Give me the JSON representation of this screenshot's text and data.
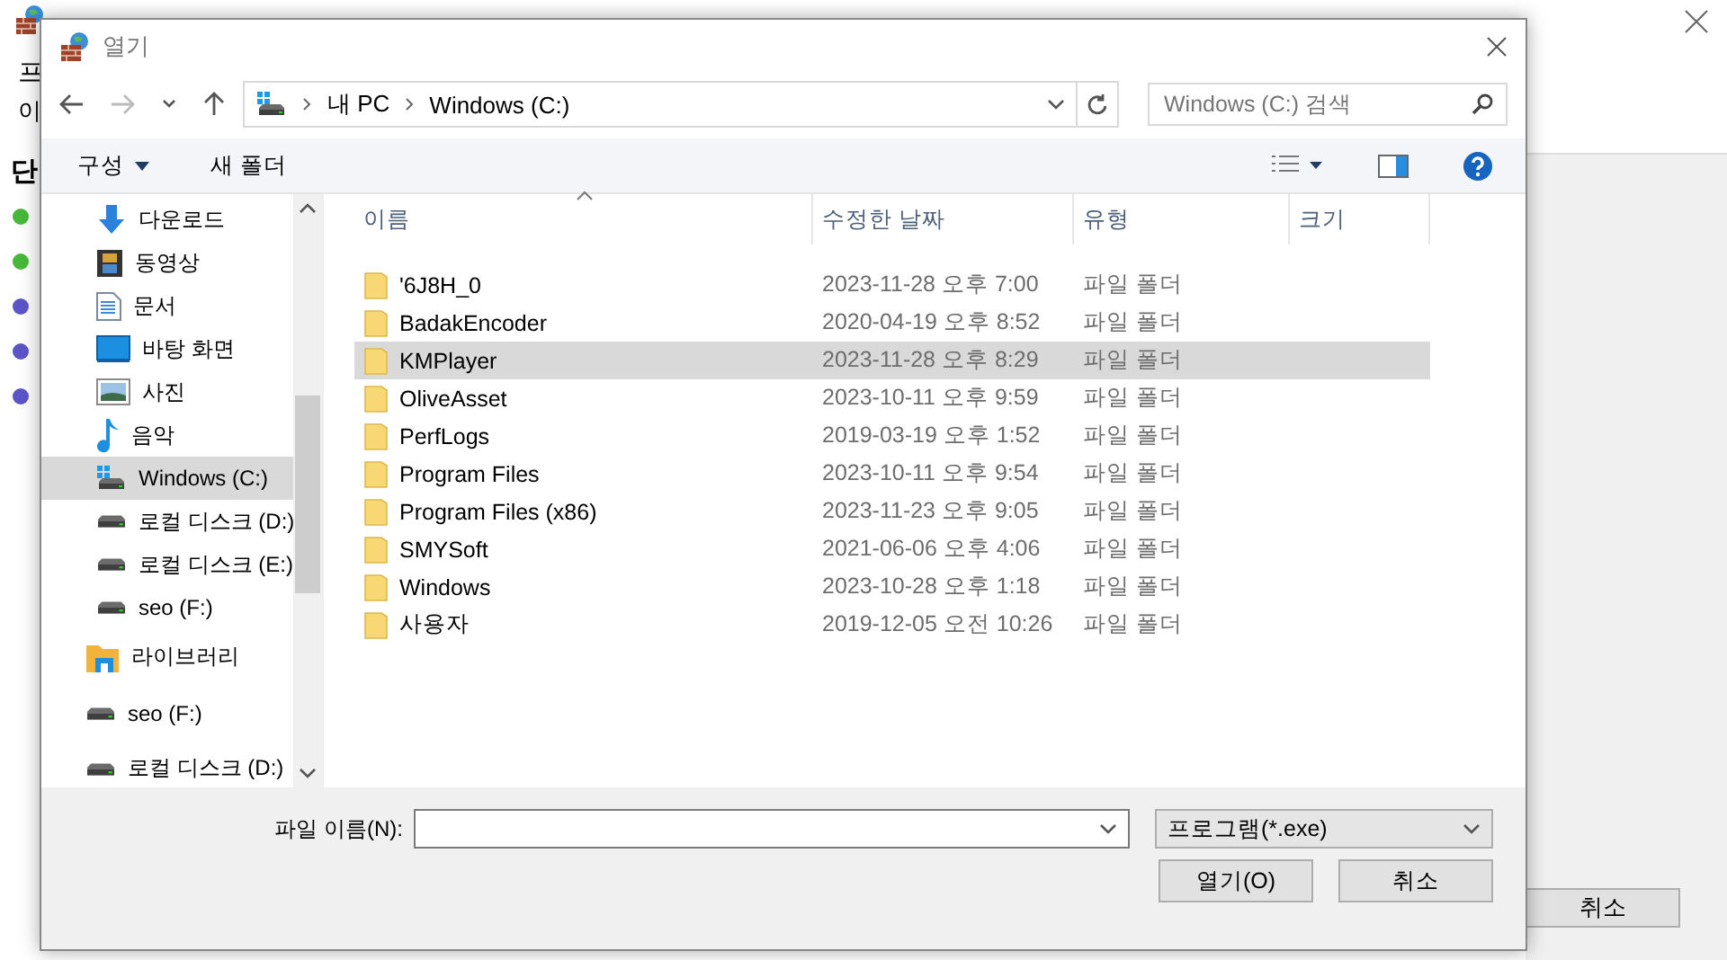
{
  "background_window": {
    "heading_fragment": "프",
    "text_fragment": "이",
    "steps_fragment": "단",
    "step_dots": [
      {
        "color": "#47b83a"
      },
      {
        "color": "#47b83a"
      },
      {
        "color": "#5b55c8"
      },
      {
        "color": "#5b55c8"
      },
      {
        "color": "#5b55c8"
      }
    ],
    "cancel_button": "취소"
  },
  "dialog": {
    "title": "열기",
    "breadcrumb": [
      "내 PC",
      "Windows (C:)"
    ],
    "search": {
      "placeholder": "Windows (C:) 검색"
    },
    "toolbar": {
      "organize": "구성",
      "new_folder": "새 폴더"
    },
    "nav_tree": [
      {
        "children": [
          {
            "label": "다운로드",
            "kind": "download",
            "selected": false
          },
          {
            "label": "동영상",
            "kind": "video",
            "selected": false
          },
          {
            "label": "문서",
            "kind": "document",
            "selected": false
          },
          {
            "label": "바탕 화면",
            "kind": "desktop",
            "selected": false
          },
          {
            "label": "사진",
            "kind": "picture",
            "selected": false
          },
          {
            "label": "음악",
            "kind": "music",
            "selected": false
          },
          {
            "label": "Windows (C:)",
            "kind": "system-drive",
            "selected": true
          },
          {
            "label": "로컬 디스크 (D:)",
            "kind": "drive",
            "selected": false
          },
          {
            "label": "로컬 디스크 (E:)",
            "kind": "drive",
            "selected": false
          },
          {
            "label": "seo (F:)",
            "kind": "drive",
            "selected": false
          }
        ]
      },
      {
        "label": "라이브러리",
        "kind": "library",
        "selected": false
      },
      {
        "label": "seo (F:)",
        "kind": "drive",
        "selected": false
      },
      {
        "label": "로컬 디스크 (D:)",
        "kind": "drive",
        "selected": false
      }
    ],
    "columns": [
      "이름",
      "수정한 날짜",
      "유형",
      "크기"
    ],
    "rows": [
      {
        "name": "'6J8H_0",
        "date": "2023-11-28 오후 7:00",
        "type": "파일 폴더",
        "selected": false
      },
      {
        "name": "BadakEncoder",
        "date": "2020-04-19 오후 8:52",
        "type": "파일 폴더",
        "selected": false
      },
      {
        "name": "KMPlayer",
        "date": "2023-11-28 오후 8:29",
        "type": "파일 폴더",
        "selected": true
      },
      {
        "name": "OliveAsset",
        "date": "2023-10-11 오후 9:59",
        "type": "파일 폴더",
        "selected": false
      },
      {
        "name": "PerfLogs",
        "date": "2019-03-19 오후 1:52",
        "type": "파일 폴더",
        "selected": false
      },
      {
        "name": "Program Files",
        "date": "2023-10-11 오후 9:54",
        "type": "파일 폴더",
        "selected": false
      },
      {
        "name": "Program Files (x86)",
        "date": "2023-11-23 오후 9:05",
        "type": "파일 폴더",
        "selected": false
      },
      {
        "name": "SMYSoft",
        "date": "2021-06-06 오후 4:06",
        "type": "파일 폴더",
        "selected": false
      },
      {
        "name": "Windows",
        "date": "2023-10-28 오후 1:18",
        "type": "파일 폴더",
        "selected": false
      },
      {
        "name": "사용자",
        "date": "2019-12-05 오전 10:26",
        "type": "파일 폴더",
        "selected": false
      }
    ],
    "filename_label": "파일 이름(N):",
    "file_type": "프로그램(*.exe)",
    "buttons": [
      "열기(O)",
      "취소"
    ]
  }
}
